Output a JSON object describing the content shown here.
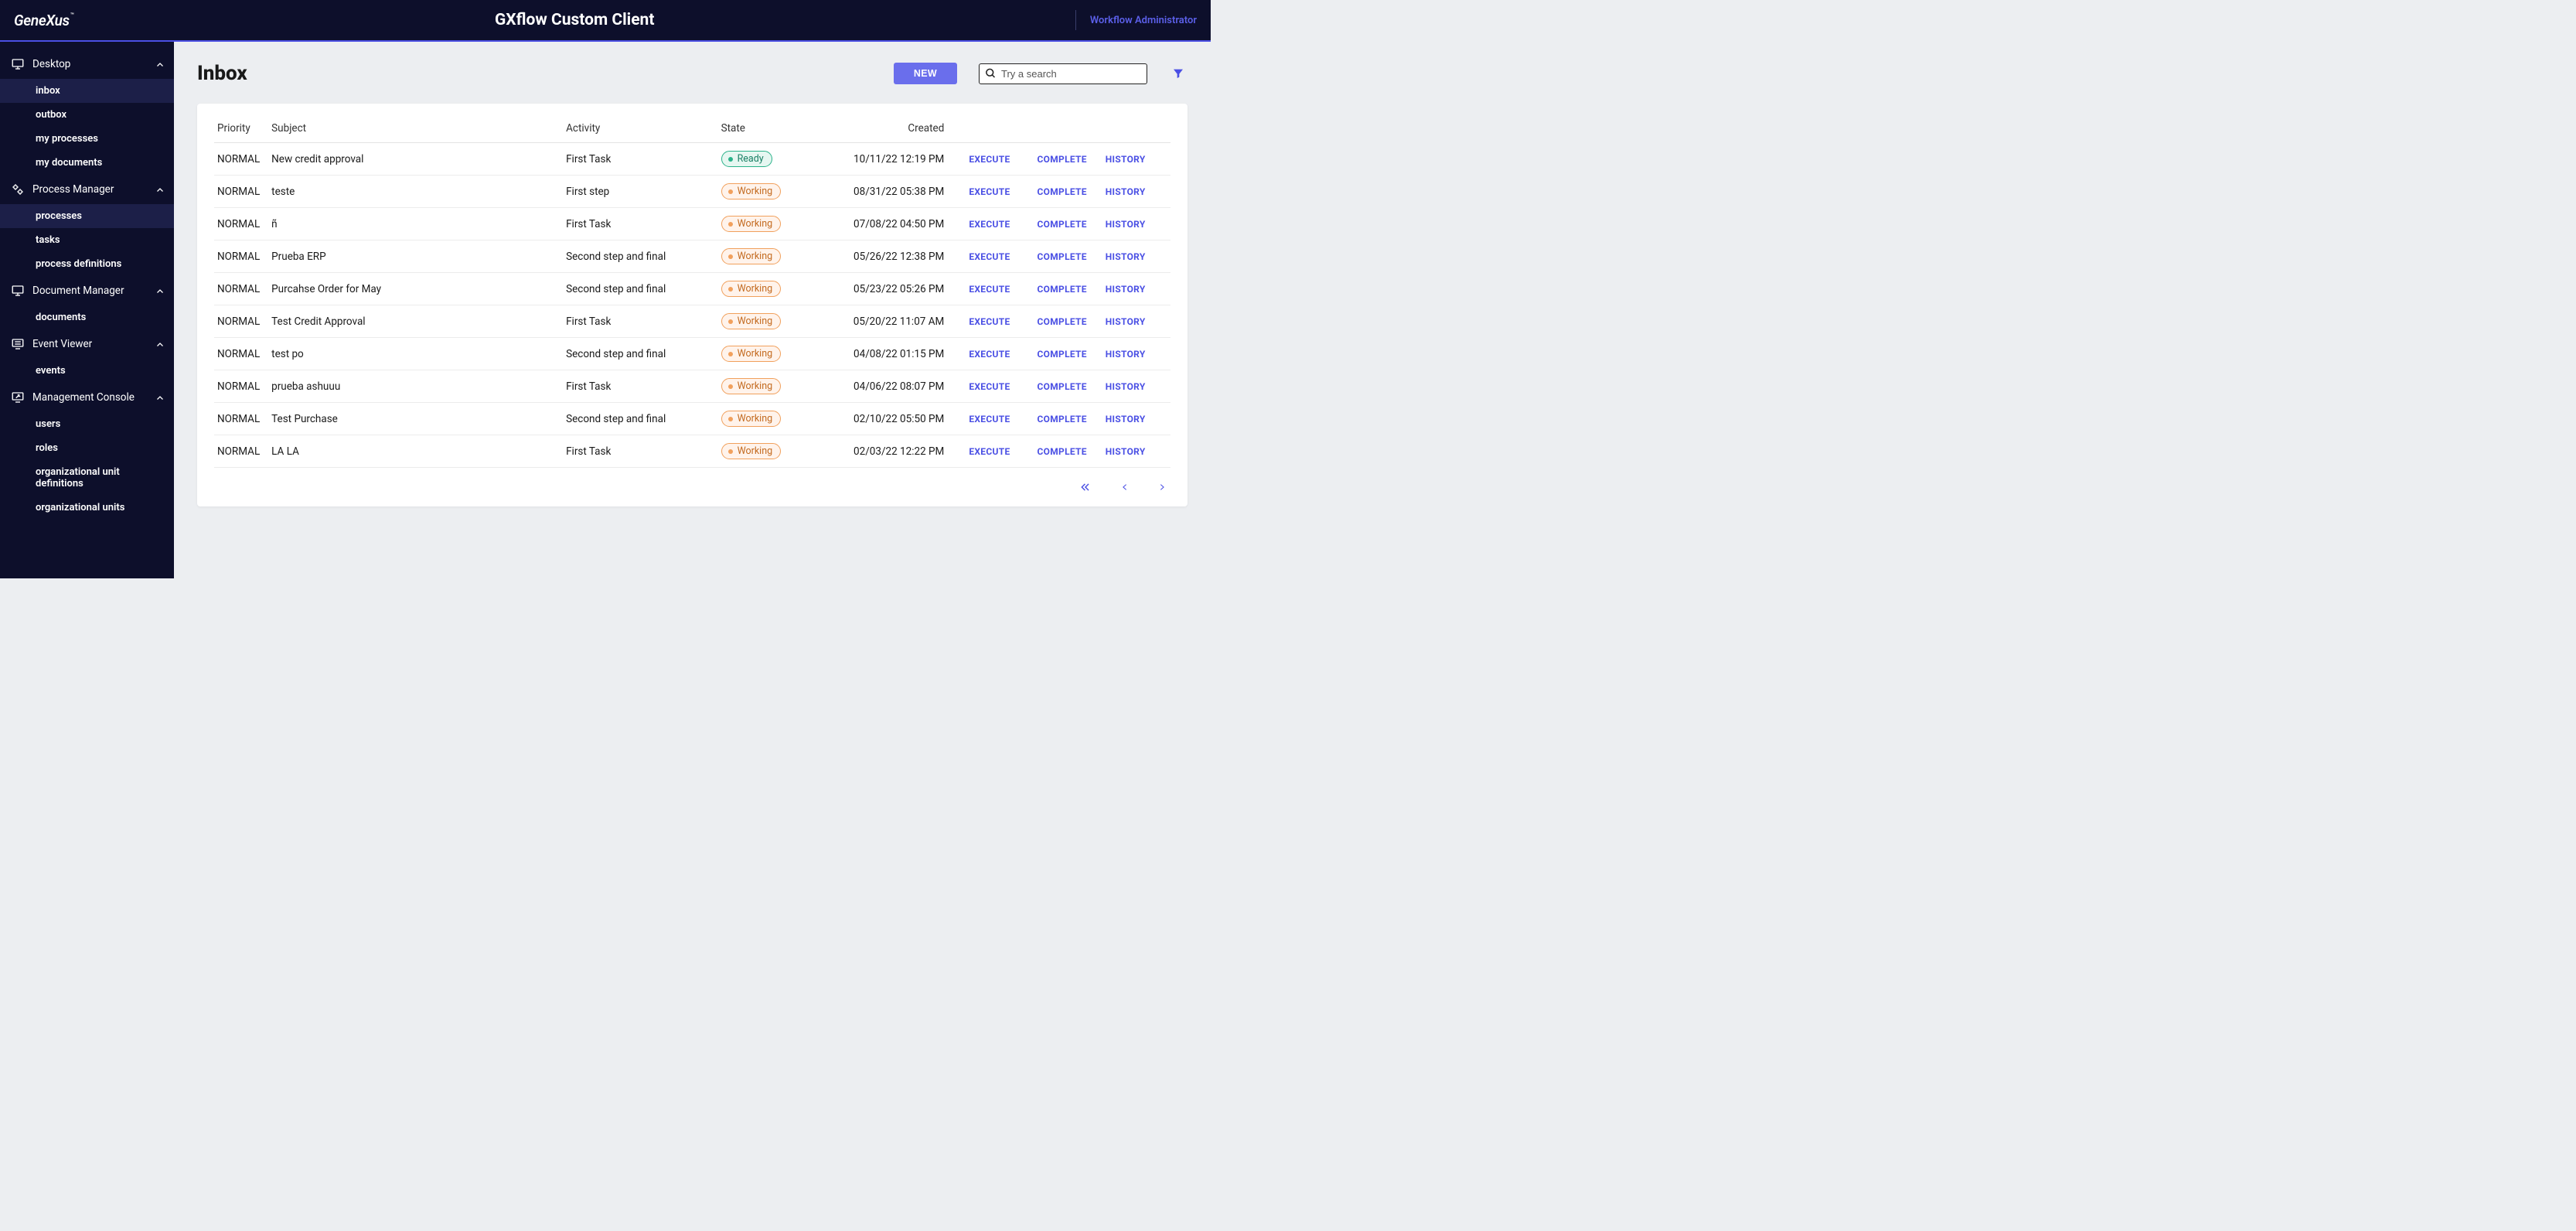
{
  "header": {
    "logo": "GeneXus",
    "logo_tm": "™",
    "title": "GXflow Custom Client",
    "user": "Workflow Administrator"
  },
  "sidebar": {
    "sections": [
      {
        "label": "Desktop",
        "icon": "monitor",
        "items": [
          {
            "label": "inbox",
            "active": true
          },
          {
            "label": "outbox"
          },
          {
            "label": "my processes"
          },
          {
            "label": "my documents"
          }
        ]
      },
      {
        "label": "Process Manager",
        "icon": "gears",
        "items": [
          {
            "label": "processes",
            "active": true
          },
          {
            "label": "tasks"
          },
          {
            "label": "process definitions"
          }
        ]
      },
      {
        "label": "Document Manager",
        "icon": "monitor",
        "items": [
          {
            "label": "documents"
          }
        ]
      },
      {
        "label": "Event Viewer",
        "icon": "monitor-list",
        "items": [
          {
            "label": "events"
          }
        ]
      },
      {
        "label": "Management Console",
        "icon": "monitor-share",
        "items": [
          {
            "label": "users"
          },
          {
            "label": "roles"
          },
          {
            "label": "organizational unit definitions"
          },
          {
            "label": "organizational units"
          }
        ]
      }
    ]
  },
  "page": {
    "title": "Inbox",
    "new_button": "NEW",
    "search_placeholder": "Try a search"
  },
  "table": {
    "columns": {
      "priority": "Priority",
      "subject": "Subject",
      "activity": "Activity",
      "state": "State",
      "created": "Created"
    },
    "actions": {
      "execute": "EXECUTE",
      "complete": "COMPLETE",
      "history": "HISTORY"
    },
    "states": {
      "ready": "Ready",
      "working": "Working"
    },
    "rows": [
      {
        "priority": "NORMAL",
        "subject": "New credit approval",
        "activity": "First Task",
        "state": "ready",
        "created": "10/11/22 12:19 PM"
      },
      {
        "priority": "NORMAL",
        "subject": "teste",
        "activity": "First step",
        "state": "working",
        "created": "08/31/22 05:38 PM"
      },
      {
        "priority": "NORMAL",
        "subject": "ñ",
        "activity": "First Task",
        "state": "working",
        "created": "07/08/22 04:50 PM"
      },
      {
        "priority": "NORMAL",
        "subject": "Prueba ERP",
        "activity": "Second step and final",
        "state": "working",
        "created": "05/26/22 12:38 PM"
      },
      {
        "priority": "NORMAL",
        "subject": "Purcahse Order for May",
        "activity": "Second step and final",
        "state": "working",
        "created": "05/23/22 05:26 PM"
      },
      {
        "priority": "NORMAL",
        "subject": "Test Credit Approval",
        "activity": "First Task",
        "state": "working",
        "created": "05/20/22 11:07 AM"
      },
      {
        "priority": "NORMAL",
        "subject": "test po",
        "activity": "Second step and final",
        "state": "working",
        "created": "04/08/22 01:15 PM"
      },
      {
        "priority": "NORMAL",
        "subject": "prueba ashuuu",
        "activity": "First Task",
        "state": "working",
        "created": "04/06/22 08:07 PM"
      },
      {
        "priority": "NORMAL",
        "subject": "Test Purchase",
        "activity": "Second step and final",
        "state": "working",
        "created": "02/10/22 05:50 PM"
      },
      {
        "priority": "NORMAL",
        "subject": "LA LA",
        "activity": "First Task",
        "state": "working",
        "created": "02/03/22 12:22 PM"
      }
    ]
  }
}
